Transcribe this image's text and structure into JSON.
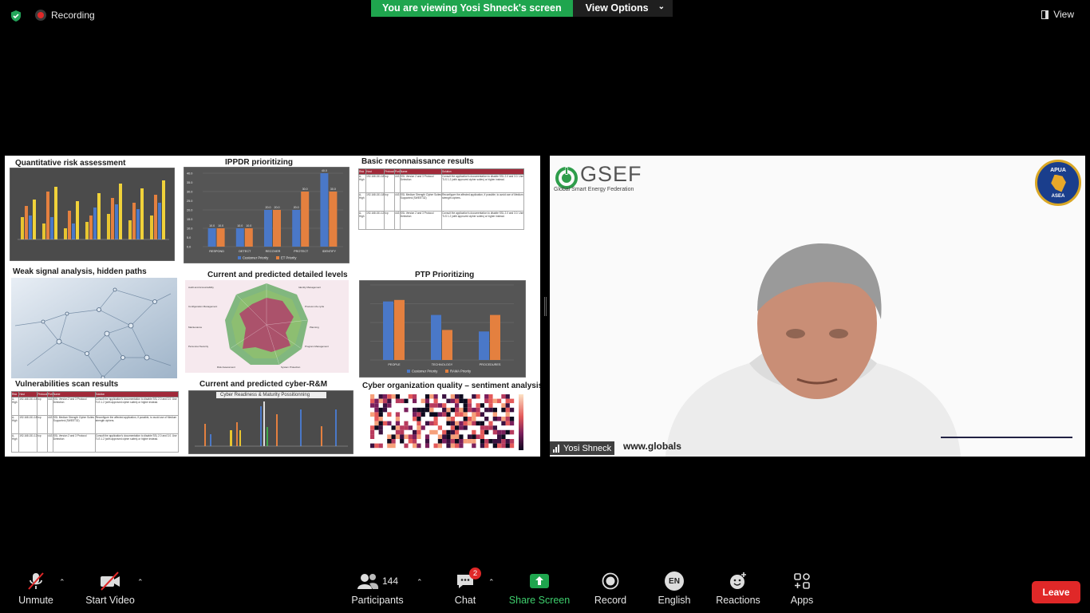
{
  "top": {
    "recording_label": "Recording",
    "viewing_label": "You are viewing Yosi Shneck's screen",
    "view_options_label": "View Options",
    "view_label": "View"
  },
  "shared_screen": {
    "panels": {
      "quant_risk": "Quantitative risk assessment",
      "ippdr": "IPPDR prioritizing",
      "basic_recon": "Basic reconnaissance results",
      "weak_signal": "Weak signal analysis, hidden paths",
      "detailed_levels": "Current and predicted detailed levels",
      "ptp": "PTP Prioritizing",
      "vuln_scan": "Vulnerabilities scan results",
      "cyber_rm": "Current and predicted cyber-R&M",
      "cyber_org": "Cyber organization quality – sentiment analysis"
    },
    "ippdr_chart": {
      "type": "bar",
      "categories": [
        "RESPOND",
        "DETECT",
        "RECOVER",
        "PROTECT",
        "IDENTIFY"
      ],
      "series": [
        {
          "name": "Customer Priority",
          "values": [
            10.0,
            10.0,
            20.0,
            20.0,
            40.0
          ],
          "color": "#4a78c8"
        },
        {
          "name": "ET Priority",
          "values": [
            10.0,
            10.0,
            20.0,
            30.0,
            30.0
          ],
          "color": "#e4803f"
        }
      ],
      "ylim": [
        0,
        40
      ],
      "yticks": [
        "40.0",
        "35.0",
        "30.0",
        "25.0",
        "20.0",
        "15.0",
        "10.0",
        "5.0",
        "0.0"
      ]
    },
    "ptp_chart": {
      "type": "bar",
      "categories": [
        "PEOPLE",
        "TECHNOLOGY",
        "PROCEDURES"
      ],
      "series": [
        {
          "name": "Customer Priority",
          "values": [
            39,
            30,
            19
          ],
          "color": "#4a78c8"
        },
        {
          "name": "RAMA Priority",
          "values": [
            40,
            20,
            30
          ],
          "color": "#e4803f"
        }
      ],
      "ylim": [
        0,
        50
      ]
    },
    "cyber_rm_title": "Cyber Readiness & Maturity Possitionning",
    "recon_table": {
      "headers": [
        "Risk",
        "Host",
        "Protocol",
        "Port",
        "Name",
        "Solution"
      ],
      "rows": [
        [
          "A-High",
          "192.168.151.18",
          "tcp",
          "443",
          "SSL Version 2 and 3 Protocol Detection",
          "Consult the application's documentation to disable SSL 2.0 and 3.0. Use TLS 1.2 (with approved cipher suites) or higher instead."
        ],
        [
          "A-High",
          "192.168.151.18",
          "tcp",
          "443",
          "SSL Medium Strength Cipher Suites Supported (SWEET32)",
          "Reconfigure the affected application, if possible, to avoid use of Medium strength ciphers."
        ],
        [
          "A-High",
          "192.168.151.12",
          "tcp",
          "443",
          "SSL Version 2 and 3 Protocol Detection",
          "Consult the application's documentation to disable SSL 2.0 and 3.0. Use TLS 1.2 (with approved cipher suites) or higher instead."
        ]
      ]
    }
  },
  "video": {
    "participant_name": "Yosi Shneck",
    "org_name": "GSEF",
    "org_subtitle": "Global Smart Energy Federation",
    "badge_line1": "APUA",
    "badge_line2": "ASEA",
    "url_fragment": "www.globals"
  },
  "toolbar": {
    "unmute": "Unmute",
    "start_video": "Start Video",
    "participants": "Participants",
    "participants_count": "144",
    "chat": "Chat",
    "chat_badge": "2",
    "share_screen": "Share Screen",
    "record": "Record",
    "language_code": "EN",
    "language": "English",
    "reactions": "Reactions",
    "apps": "Apps",
    "leave": "Leave"
  },
  "colors": {
    "share_green": "#1fa54e",
    "leave_red": "#e02828",
    "background": "#000000"
  }
}
